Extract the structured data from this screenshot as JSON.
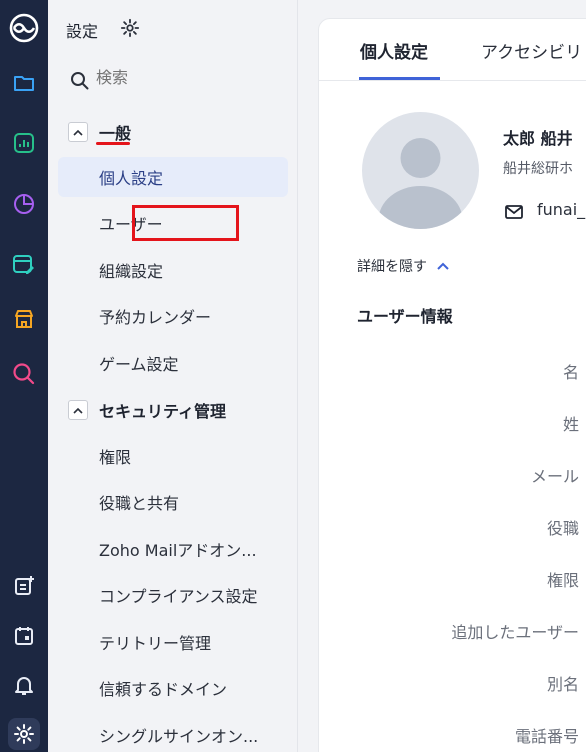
{
  "rail": {
    "icons": [
      "zoho-logo-icon",
      "folder-icon",
      "analytics-icon",
      "pie-chart-icon",
      "calendar-edit-icon",
      "store-icon",
      "search-analytics-icon",
      "add-note-icon",
      "calendar-icon",
      "bell-icon",
      "gear-icon"
    ]
  },
  "sidebar": {
    "title": "設定",
    "search_placeholder": "検索",
    "groups": [
      {
        "label": "一般",
        "items": [
          "個人設定",
          "ユーザー",
          "組織設定",
          "予約カレンダー",
          "ゲーム設定"
        ]
      },
      {
        "label": "セキュリティ管理",
        "items": [
          "権限",
          "役職と共有",
          "Zoho Mailアドオン...",
          "コンプライアンス設定",
          "テリトリー管理",
          "信頼するドメイン",
          "シングルサインオン..."
        ]
      }
    ],
    "active_item": "個人設定",
    "highlight_color": "#e4141b"
  },
  "main": {
    "tabs": [
      "個人設定",
      "アクセシビリ"
    ],
    "user": {
      "name": "太郎 船井",
      "org": "船井総研ホ",
      "email": "funai_"
    },
    "toggle_details": "詳細を隠す",
    "section_title": "ユーザー情報",
    "field_labels": [
      "名",
      "姓",
      "メール",
      "役職",
      "権限",
      "追加したユーザー",
      "別名",
      "電話番号"
    ],
    "accent_color": "#3f63d8"
  }
}
